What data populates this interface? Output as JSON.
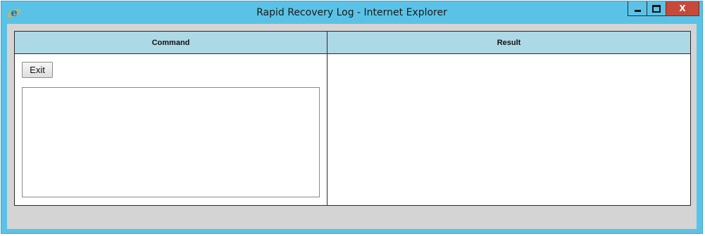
{
  "window": {
    "title": "Rapid Recovery Log - Internet Explorer",
    "app_icon": "internet-explorer-icon",
    "controls": {
      "minimize_icon": "minimize-icon",
      "maximize_icon": "maximize-icon",
      "close_label": "X"
    }
  },
  "grid": {
    "columns": [
      {
        "label": "Command"
      },
      {
        "label": "Result"
      }
    ]
  },
  "command": {
    "exit_label": "Exit",
    "text_value": ""
  },
  "result": {
    "text": ""
  },
  "colors": {
    "titlebar": "#5bc2e7",
    "header": "#add8e6",
    "client_bg": "#d4d4d4",
    "close_button": "#c7493a"
  }
}
